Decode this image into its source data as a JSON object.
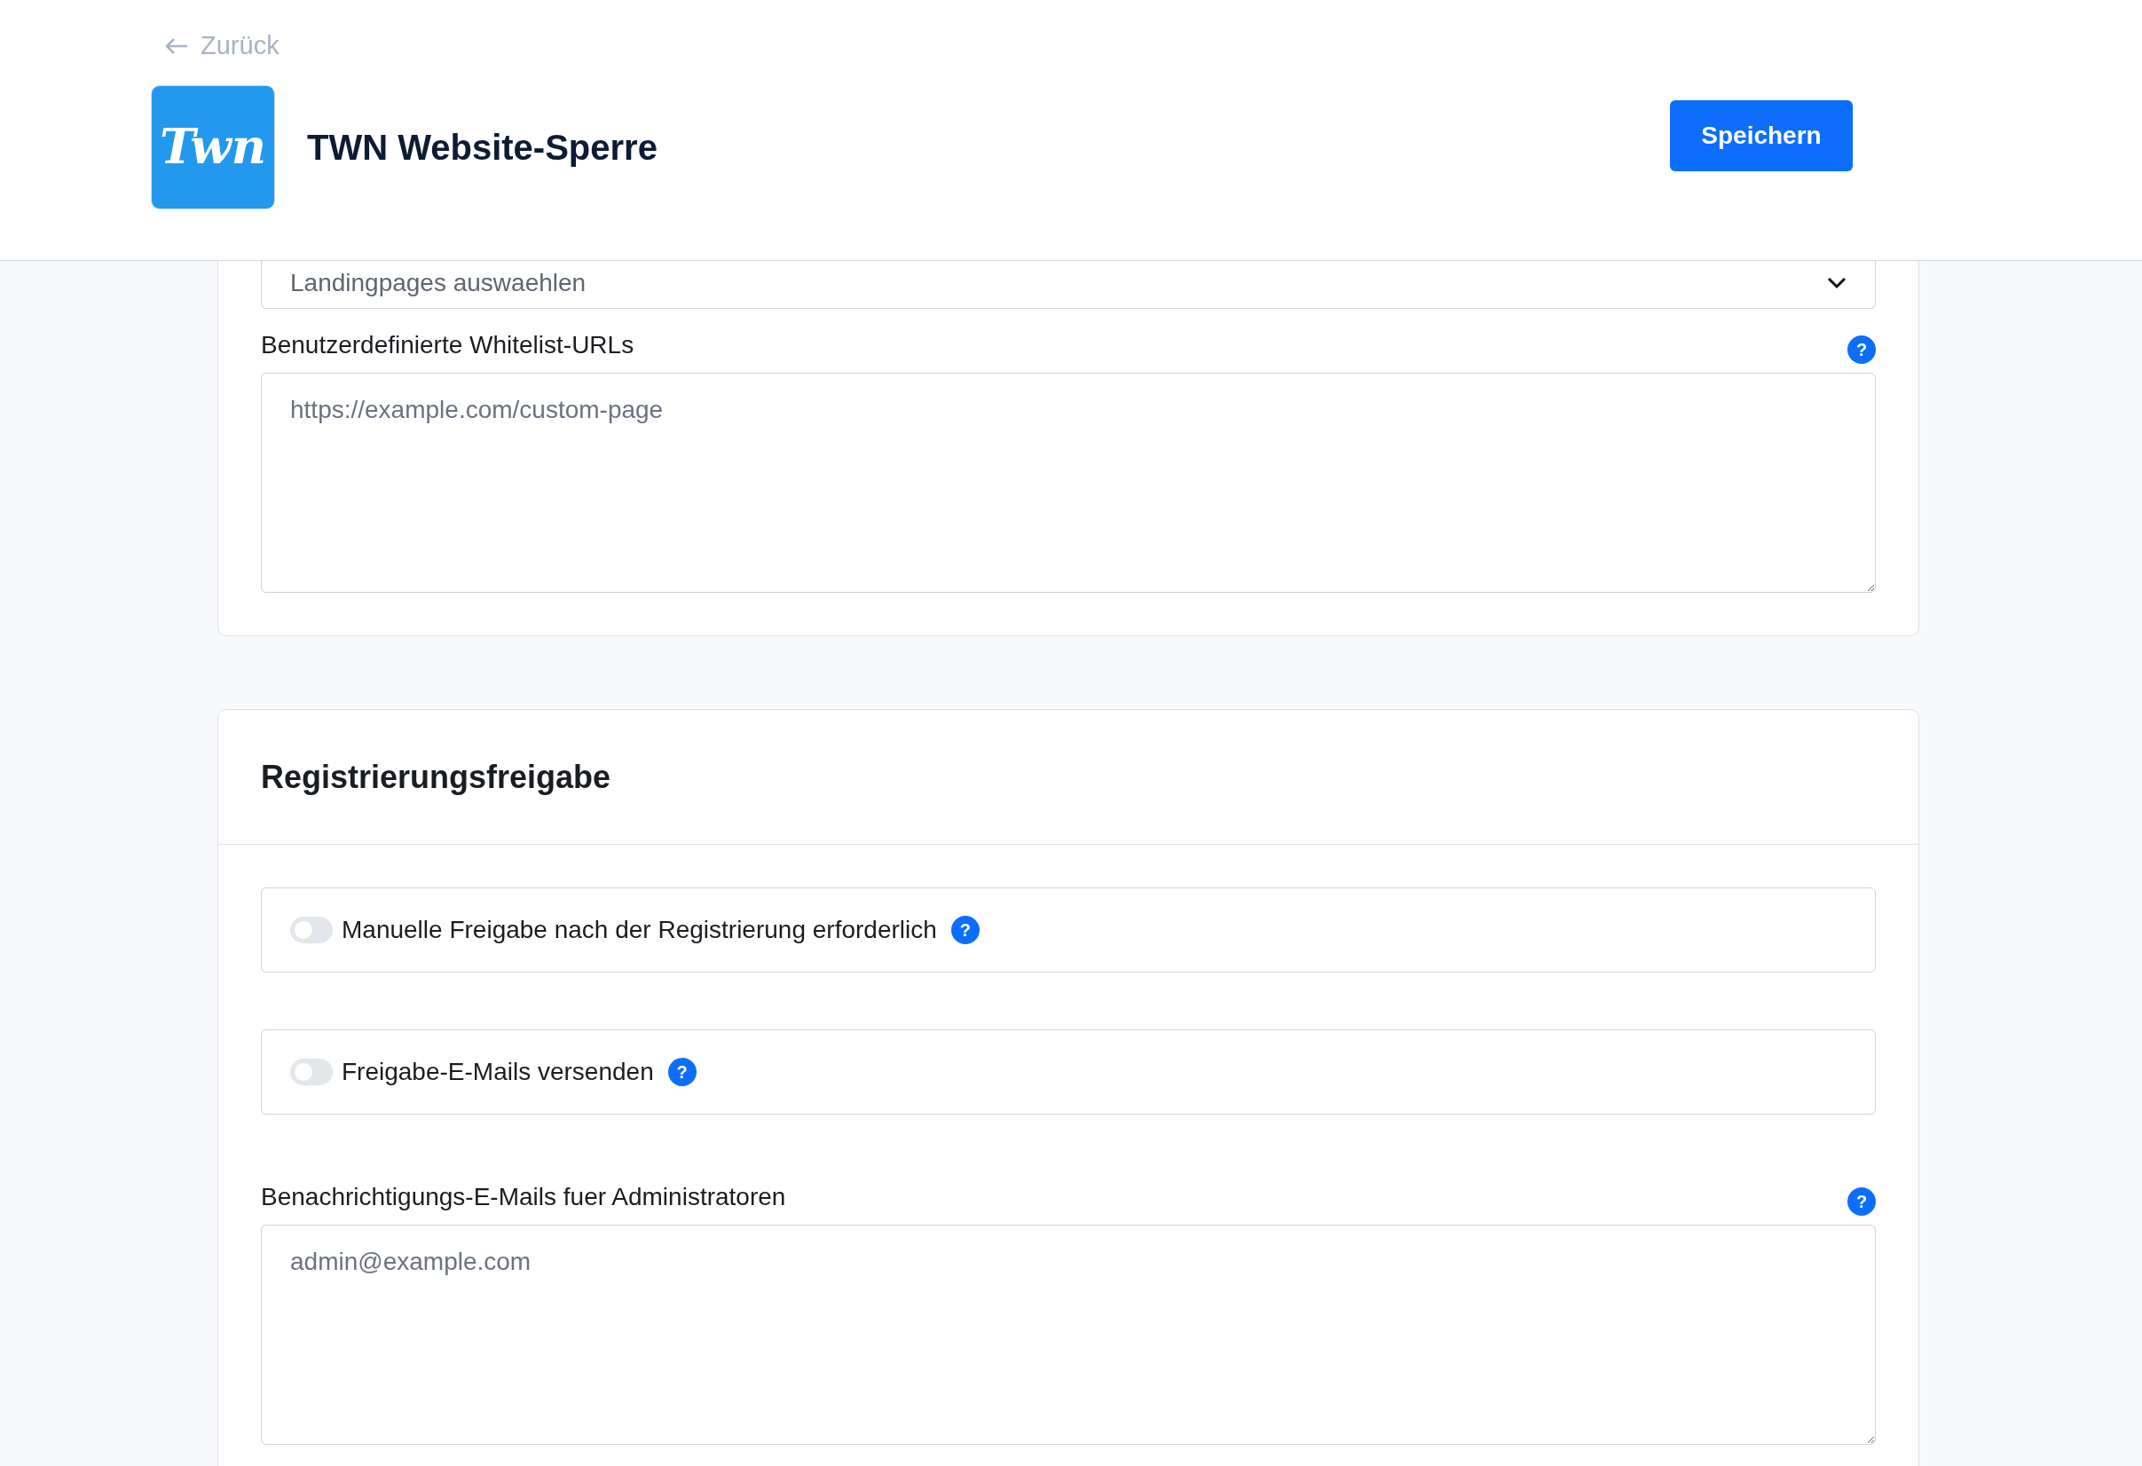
{
  "header": {
    "back_link": "Zurück",
    "logo_text": "Twn",
    "title": "TWN Website-Sperre",
    "save_button": "Speichern"
  },
  "whitelist_card": {
    "select": {
      "placeholder": "Landingpages auswaehlen"
    },
    "custom_urls": {
      "label": "Benutzerdefinierte Whitelist-URLs",
      "placeholder": "https://example.com/custom-page",
      "help": "?"
    }
  },
  "registration_card": {
    "title": "Registrierungsfreigabe",
    "toggles": [
      {
        "label": "Manuelle Freigabe nach der Registrierung erforderlich",
        "on": false,
        "help": "?"
      },
      {
        "label": "Freigabe-E-Mails versenden",
        "on": false,
        "help": "?"
      }
    ],
    "admin_emails": {
      "label": "Benachrichtigungs-E-Mails fuer Administratoren",
      "placeholder": "admin@example.com",
      "help": "?"
    }
  }
}
